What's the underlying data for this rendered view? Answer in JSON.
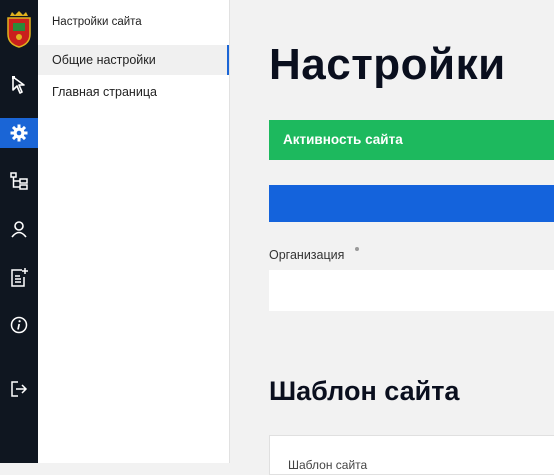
{
  "sidebar": {
    "header": "Настройки сайта",
    "items": [
      {
        "label": "Общие настройки",
        "active": true
      },
      {
        "label": "Главная страница",
        "active": false
      }
    ]
  },
  "rail": {
    "icons": [
      "coat-of-arms-logo",
      "cursor-icon",
      "gear-icon",
      "tree-structure-icon",
      "user-icon",
      "document-add-icon",
      "info-icon",
      "logout-icon"
    ],
    "active_icon": "gear-icon",
    "accent": "#1a65d6"
  },
  "main": {
    "title": "Настройки",
    "activity_button": "Активность сайта",
    "activity_color": "#1db95e",
    "organization_label": "Организация",
    "organization_value": "",
    "section_title": "Шаблон сайта",
    "panel_label": "Шаблон сайта"
  }
}
